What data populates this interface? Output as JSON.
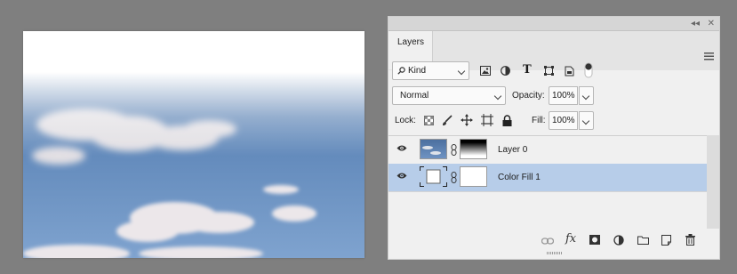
{
  "panel": {
    "collapse_glyph": "◂◂",
    "close_glyph": "✕",
    "tab_label": "Layers",
    "menu_icon": "hamburger-menu-icon"
  },
  "filter": {
    "kind_label": "Kind",
    "icons": [
      "image-filter-icon",
      "adjustment-filter-icon",
      "type-filter-icon",
      "shape-filter-icon",
      "smart-object-filter-icon",
      "filter-toggle-icon"
    ]
  },
  "blend": {
    "mode": "Normal",
    "opacity_label": "Opacity:",
    "opacity_value": "100%"
  },
  "lock": {
    "label": "Lock:",
    "icons": [
      "lock-transparent-pixels-icon",
      "lock-image-pixels-icon",
      "lock-position-icon",
      "lock-artboard-icon",
      "lock-all-icon"
    ],
    "fill_label": "Fill:",
    "fill_value": "100%"
  },
  "layers": [
    {
      "name": "Layer 0",
      "visible": true,
      "selected": false
    },
    {
      "name": "Color Fill 1",
      "visible": true,
      "selected": true
    }
  ],
  "bottom_icons": [
    "link-layers-icon",
    "fx-icon",
    "add-mask-icon",
    "new-adjustment-icon",
    "new-group-icon",
    "new-layer-icon",
    "delete-layer-icon"
  ],
  "bottom_fx_text": "fx",
  "colors": {
    "background": "#7f7f7f",
    "panel": "#f0f0f0",
    "selection": "#b7cde9",
    "sky": "#5a7fb0"
  }
}
